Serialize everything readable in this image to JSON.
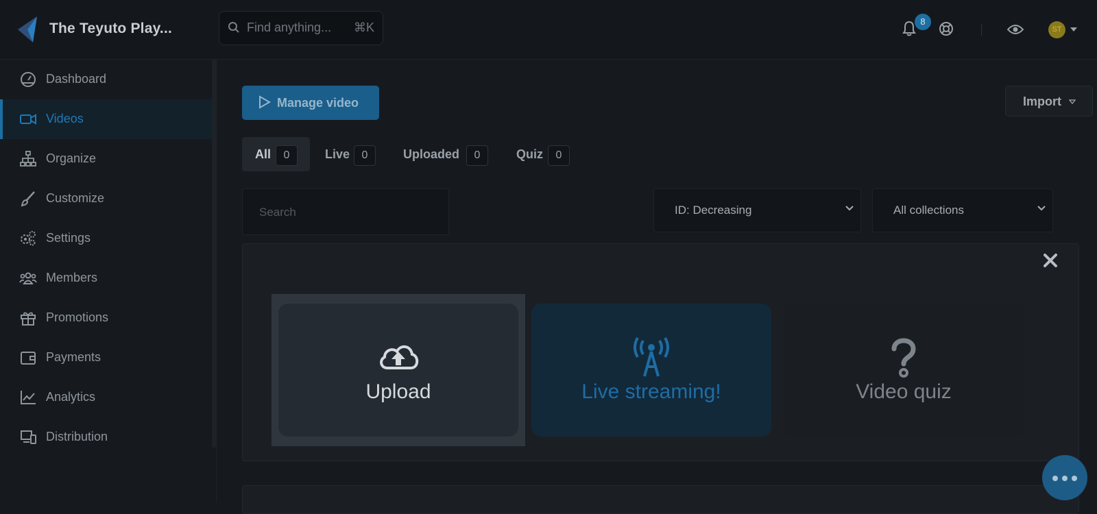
{
  "app": {
    "brand": "The Teyuto Play..."
  },
  "header": {
    "search_placeholder": "Find anything...",
    "search_shortcut": "⌘K",
    "notifications_count": "8",
    "avatar_initials": "ST",
    "icons": [
      "search-icon",
      "bell-icon",
      "lifebuoy-icon",
      "eye-icon",
      "chevron-down-icon"
    ]
  },
  "sidebar": {
    "items": [
      {
        "label": "Dashboard",
        "icon": "speedometer-icon",
        "active": false
      },
      {
        "label": "Videos",
        "icon": "video-camera-icon",
        "active": true
      },
      {
        "label": "Organize",
        "icon": "sitemap-icon",
        "active": false
      },
      {
        "label": "Customize",
        "icon": "brush-icon",
        "active": false
      },
      {
        "label": "Settings",
        "icon": "gears-icon",
        "active": false
      },
      {
        "label": "Members",
        "icon": "users-icon",
        "active": false
      },
      {
        "label": "Promotions",
        "icon": "gift-icon",
        "active": false
      },
      {
        "label": "Payments",
        "icon": "wallet-icon",
        "active": false
      },
      {
        "label": "Analytics",
        "icon": "chart-line-icon",
        "active": false
      },
      {
        "label": "Distribution",
        "icon": "devices-icon",
        "active": false
      }
    ]
  },
  "toolbar": {
    "manage_label": "Manage video",
    "import_label": "Import"
  },
  "tabs": [
    {
      "label": "All",
      "count": "0",
      "active": true
    },
    {
      "label": "Live",
      "count": "0",
      "active": false
    },
    {
      "label": "Uploaded",
      "count": "0",
      "active": false
    },
    {
      "label": "Quiz",
      "count": "0",
      "active": false
    }
  ],
  "filters": {
    "search_placeholder": "Search",
    "sort_value": "ID: Decreasing",
    "collection_value": "All collections"
  },
  "options": [
    {
      "label": "Upload",
      "icon": "cloud-upload-icon"
    },
    {
      "label": "Live streaming!",
      "icon": "broadcast-tower-icon"
    },
    {
      "label": "Video quiz",
      "icon": "question-icon"
    }
  ],
  "colors": {
    "accent": "#1d6fa3",
    "background": "#161a1f",
    "panel": "#1b1f24"
  }
}
